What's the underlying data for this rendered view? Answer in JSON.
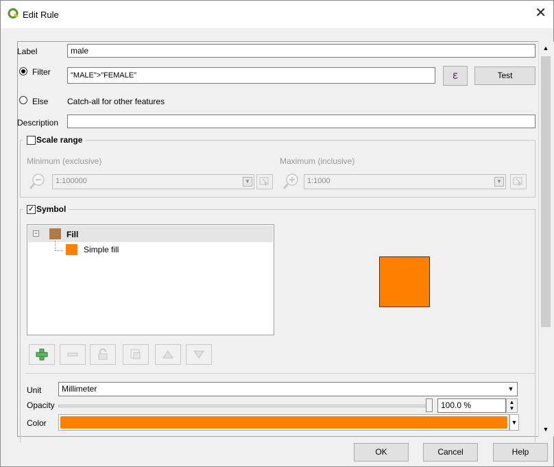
{
  "window": {
    "title": "Edit Rule",
    "close_glyph": "✕",
    "app_icon": "qgis-q-icon"
  },
  "rule": {
    "label_caption": "Label",
    "label_value": "male",
    "filter_caption": "Filter",
    "filter_value": "\"MALE\">\"FEMALE\"",
    "expression_button": "ε",
    "test_button": "Test",
    "else_caption": "Else",
    "else_text": "Catch-all for other features",
    "description_caption": "Description",
    "description_value": ""
  },
  "scale_range": {
    "title": "Scale range",
    "checked": false,
    "minimum_caption": "Minimum (exclusive)",
    "minimum_value": "1:100000",
    "maximum_caption": "Maximum (inclusive)",
    "maximum_value": "1:1000"
  },
  "symbol": {
    "title": "Symbol",
    "checked": true,
    "tree": [
      {
        "label": "Fill",
        "color": "#b07a48",
        "bold": true
      },
      {
        "label": "Simple fill",
        "color": "#ff7f00",
        "bold": false
      }
    ],
    "preview_color": "#ff7f00",
    "tools": [
      "add-layer-icon",
      "remove-layer-icon",
      "lock-icon",
      "duplicate-icon",
      "move-up-icon",
      "move-down-icon"
    ]
  },
  "properties": {
    "unit_caption": "Unit",
    "unit_value": "Millimeter",
    "opacity_caption": "Opacity",
    "opacity_value": "100.0 %",
    "opacity_fraction": 1.0,
    "color_caption": "Color",
    "color_value": "#ff7f00"
  },
  "footer": {
    "ok": "OK",
    "cancel": "Cancel",
    "help": "Help"
  }
}
